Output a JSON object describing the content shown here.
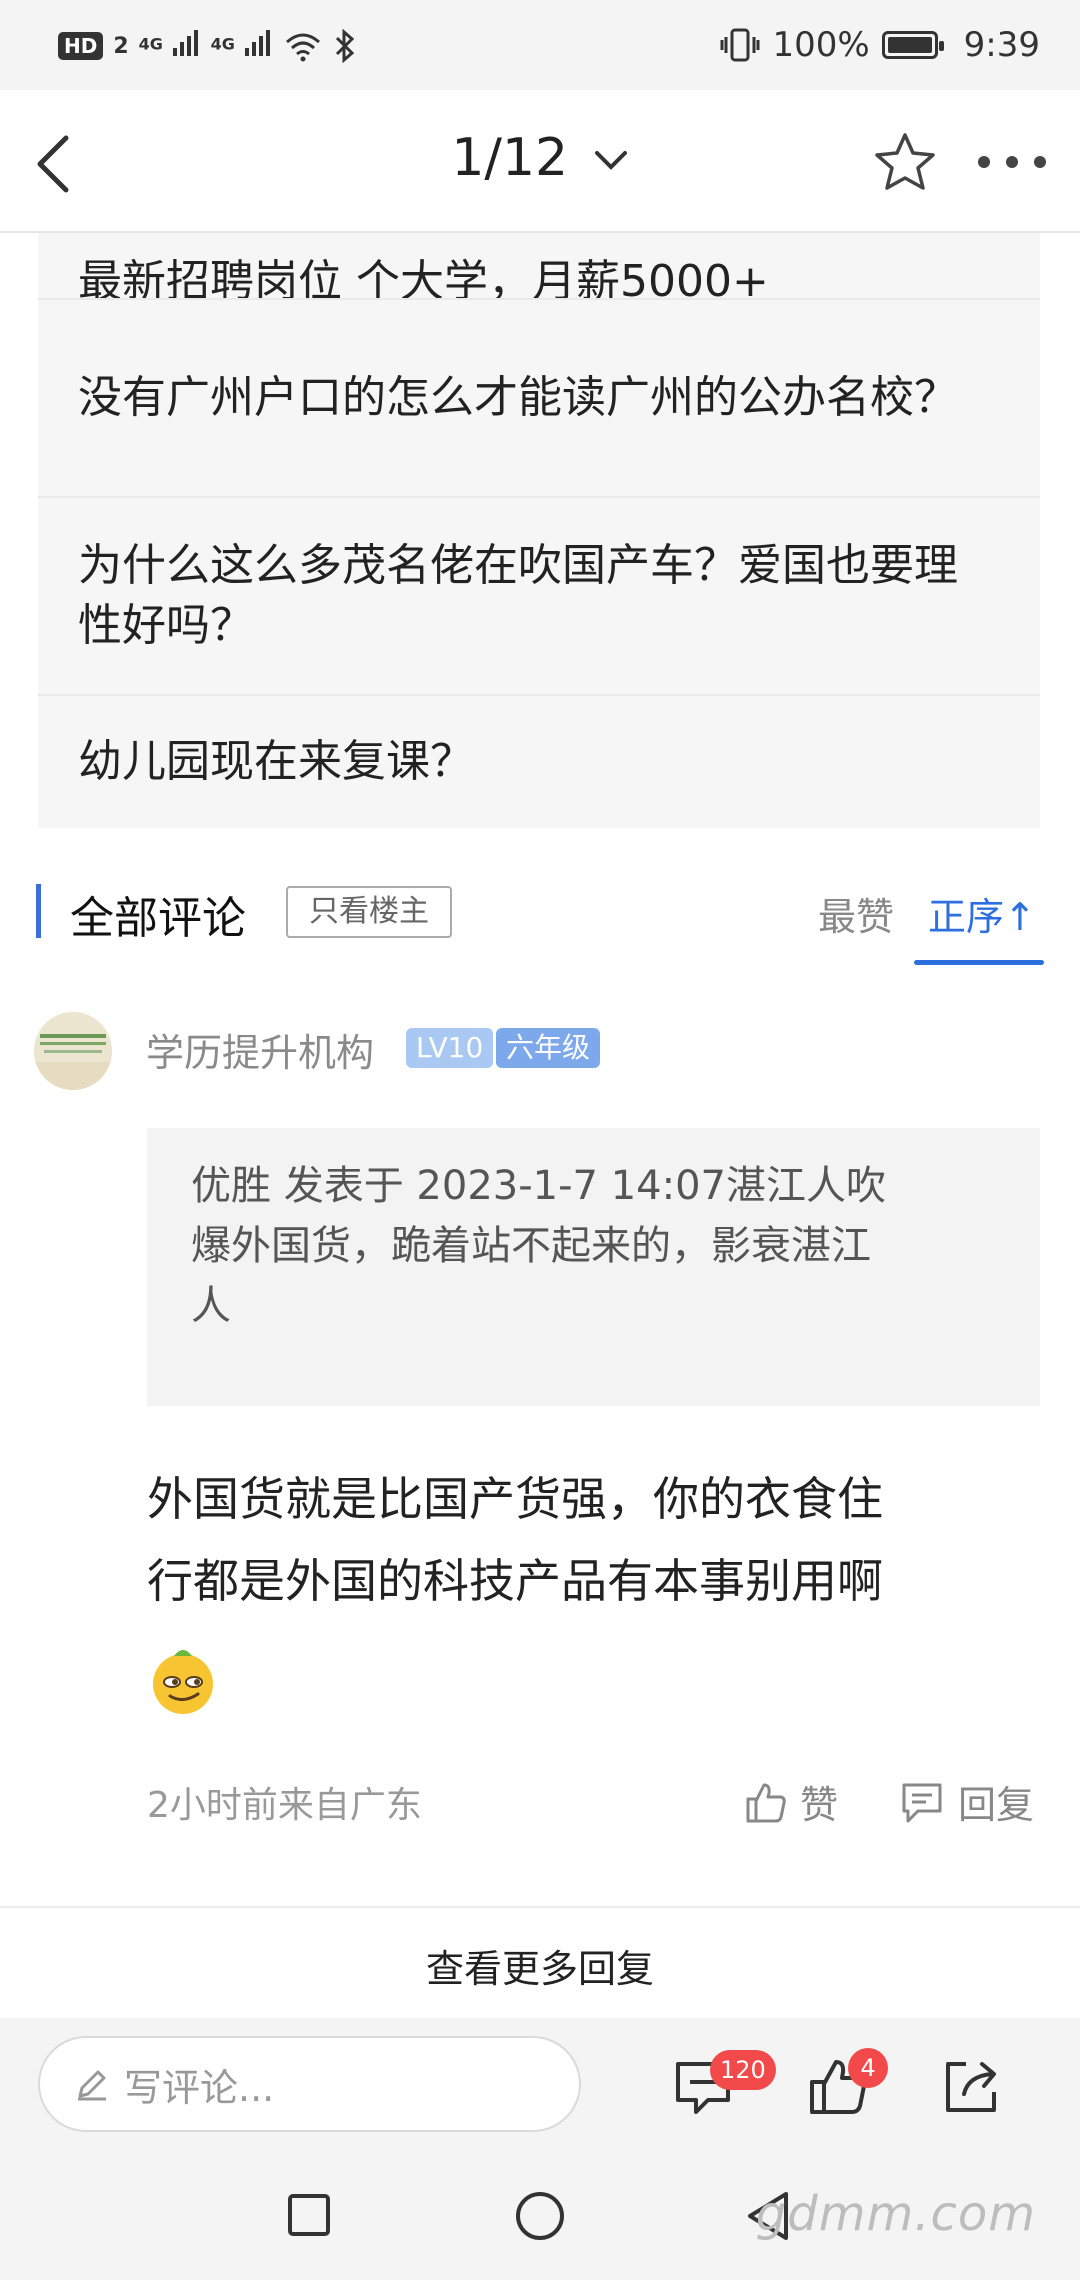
{
  "status_bar": {
    "hd": "HD",
    "sim": "2",
    "net1": "4G",
    "net2": "4G",
    "battery": "100%",
    "time": "9:39"
  },
  "nav": {
    "page_indicator": "1/12",
    "icons": [
      "back-arrow-icon",
      "chevron-down-icon",
      "star-icon",
      "more-dots-icon"
    ]
  },
  "related": {
    "items": [
      {
        "title": "最新招聘岗位 个大学，月薪5000+"
      },
      {
        "title": "没有广州户口的怎么才能读广州的公办名校？"
      },
      {
        "title": "为什么这么多茂名佬在吹国产车？爱国也要理性好吗？"
      },
      {
        "title": "幼儿园现在来复课？"
      }
    ]
  },
  "comments_header": {
    "title": "全部评论",
    "only_op": "只看楼主",
    "sort_hot": "最赞",
    "sort_order": "正序↑",
    "accent": "#2d6ee0"
  },
  "comment": {
    "user": "学历提升机构",
    "level": "LV10",
    "grade": "六年级",
    "level_color": "#9fc2f0",
    "grade_color": "#6f9fe8",
    "quote_line1": "优胜 发表于 2023-1-7 14:07湛江人吹",
    "quote_line2": "爆外国货，跪着站不起来的，影衰湛江",
    "quote_line3": "人",
    "body_line1": "外国货就是比国产货强，你的衣食住",
    "body_line2": "行都是外国的科技产品有本事别用啊",
    "emoji": "smirk-emoji",
    "meta": "2小时前来自广东",
    "like_label": "赞",
    "reply_label": "回复"
  },
  "more_replies": "查看更多回复",
  "bottom_bar": {
    "input_placeholder": "写评论...",
    "comment_count": "120",
    "like_count": "4"
  },
  "watermark": "gdmm.com"
}
